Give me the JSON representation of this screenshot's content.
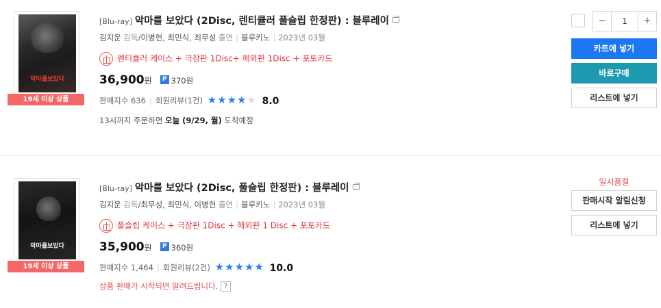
{
  "items": [
    {
      "cover_title": "악마를보았다",
      "age_badge": "19세 이상 상품",
      "format": "[Blu-ray]",
      "title": "악마를 보았다 (2Disc, 렌티큘러 풀슬립 한정판) : 블루레이",
      "director": "김지운",
      "director_role": "감독",
      "cast": "이병헌, 최민식, 최무성",
      "cast_role": "출연",
      "publisher": "블루키노",
      "date": "2023년 03월",
      "gift_text": "렌티큘러 케이스 + 극장판 1Disc+ 해외판 1Disc + 포토카드",
      "price": "36,900",
      "won": "원",
      "points": "370원",
      "sales_label": "판매지수",
      "sales_index": "636",
      "reviews": "회원리뷰(1건)",
      "rating_stars": 4,
      "rating": "8.0",
      "delivery_prefix": "13시까지 주문하면",
      "delivery_date": "오늘 (9/29, 월)",
      "delivery_suffix": "도착예정",
      "quantity": "1",
      "cart_label": "카트에 넣기",
      "buy_label": "바로구매",
      "list_label": "리스트에 넣기"
    },
    {
      "cover_title": "악마를보았다",
      "age_badge": "19세 이상 상품",
      "format": "[Blu-ray]",
      "title": "악마를 보았다 (2Disc, 풀슬립 한정판) : 블루레이",
      "director": "김지운",
      "director_role": "감독",
      "cast": "최무성, 최민식, 이병헌",
      "cast_role": "출연",
      "publisher": "블루키노",
      "date": "2023년 03월",
      "gift_text": "풀슬립 케이스 + 극장판 1Disc + 해외판 1 Disc + 포토카드",
      "price": "35,900",
      "won": "원",
      "points": "360원",
      "sales_label": "판매지수",
      "sales_index": "1,464",
      "reviews": "회원리뷰(2건)",
      "rating_stars": 5,
      "rating": "10.0",
      "notice": "상품 판매가 시작되면 알려드립니다.",
      "soldout_label": "일시품절",
      "alarm_label": "판매시작 알림신청",
      "list_label": "리스트에 넣기"
    }
  ],
  "icons": {
    "gift": "gift-icon",
    "points": "P",
    "help": "?",
    "popup": "popup-icon",
    "minus": "−",
    "plus": "+"
  },
  "colors": {
    "accent_blue": "#1b78f2",
    "buy_teal": "#1d9aaf",
    "alert_red": "#e34a4a",
    "star_blue": "#2e7cf6"
  }
}
